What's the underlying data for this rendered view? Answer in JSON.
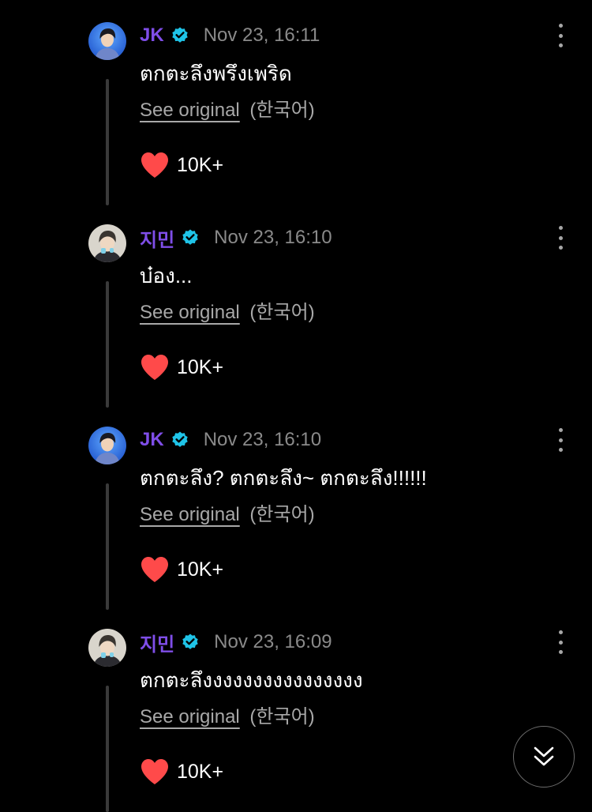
{
  "colors": {
    "background": "#000000",
    "author": "#7f4ee8",
    "verified": "#1fc4e8",
    "timestamp": "#8a8a8a",
    "heart": "#ff4a4a",
    "see_original": "#a8a8a8",
    "thread_line": "#3a3a3a"
  },
  "comments": [
    {
      "author": "JK",
      "avatar": "avatar-jk",
      "verified_icon": "verified-badge-icon",
      "timestamp": "Nov 23, 16:11",
      "text": "ตกตะลึงพรึงเพริด",
      "see_original": "See original",
      "language": "(한국어)",
      "like_icon": "heart-icon",
      "likes": "10K+"
    },
    {
      "author": "지민",
      "avatar": "avatar-jimin",
      "verified_icon": "verified-badge-icon",
      "timestamp": "Nov 23, 16:10",
      "text": "บ๋อง...",
      "see_original": "See original",
      "language": "(한국어)",
      "like_icon": "heart-icon",
      "likes": "10K+"
    },
    {
      "author": "JK",
      "avatar": "avatar-jk",
      "verified_icon": "verified-badge-icon",
      "timestamp": "Nov 23, 16:10",
      "text": "ตกตะลึง? ตกตะลึง~ ตกตะลึง!!!!!!",
      "see_original": "See original",
      "language": "(한국어)",
      "like_icon": "heart-icon",
      "likes": "10K+"
    },
    {
      "author": "지민",
      "avatar": "avatar-jimin",
      "verified_icon": "verified-badge-icon",
      "timestamp": "Nov 23, 16:09",
      "text": "ตกตะลึงงงงงงงงงงงงงงงง",
      "see_original": "See original",
      "language": "(한국어)",
      "like_icon": "heart-icon",
      "likes": "10K+"
    }
  ],
  "scroll_button_icon": "double-chevron-down-icon"
}
